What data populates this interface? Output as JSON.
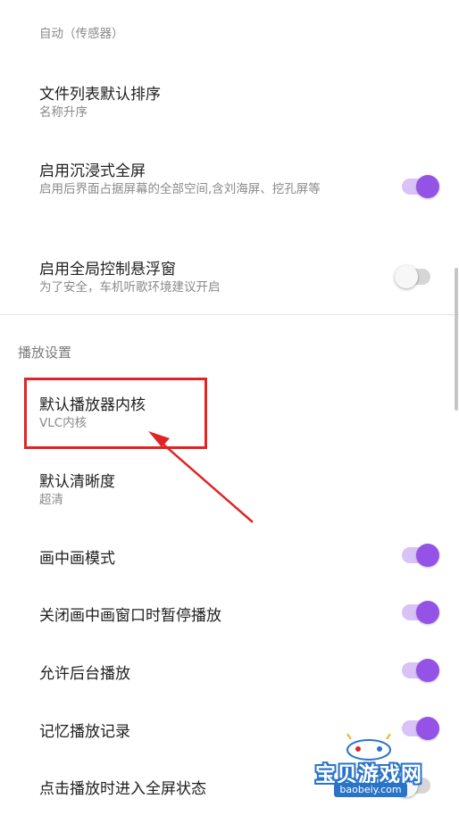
{
  "rows": {
    "orientation": {
      "sub": "自动（传感器）"
    },
    "file_sort": {
      "title": "文件列表默认排序",
      "sub": "名称升序"
    },
    "immersive": {
      "title": "启用沉浸式全屏",
      "sub": "启用后界面占据屏幕的全部空间,含刘海屏、挖孔屏等",
      "on": true
    },
    "global_float": {
      "title": "启用全局控制悬浮窗",
      "sub": "为了安全，车机听歌环境建议开启",
      "on": false
    },
    "default_core": {
      "title": "默认播放器内核",
      "sub": "VLC内核"
    },
    "default_quality": {
      "title": "默认清晰度",
      "sub": "超清"
    },
    "pip_mode": {
      "title": "画中画模式",
      "on": true
    },
    "pause_on_pip_close": {
      "title": "关闭画中画窗口时暂停播放",
      "on": true
    },
    "background_play": {
      "title": "允许后台播放",
      "on": true
    },
    "remember_progress": {
      "title": "记忆播放记录",
      "on": true
    },
    "fullscreen_on_play": {
      "title": "点击播放时进入全屏状态",
      "on": false
    }
  },
  "section": {
    "playback": "播放设置"
  },
  "watermark": {
    "text": "宝贝游戏网",
    "url": "baobeiy.com"
  },
  "colors": {
    "accent": "#9552e6",
    "annotation": "#e02424"
  }
}
